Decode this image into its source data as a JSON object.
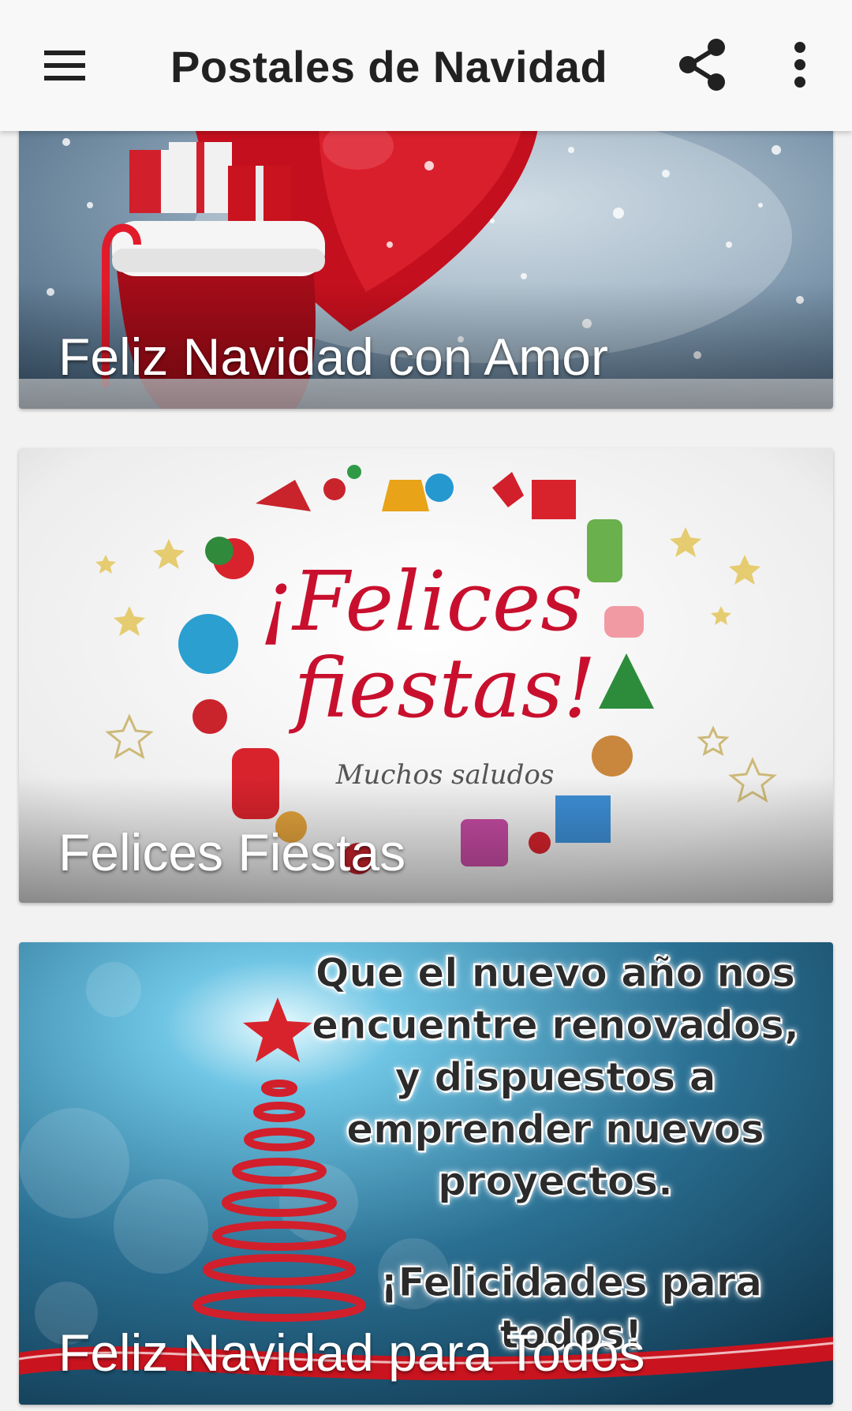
{
  "appbar": {
    "title": "Postales de Navidad",
    "menu_icon": "hamburger-menu-icon",
    "share_icon": "share-icon",
    "more_icon": "more-vert-icon"
  },
  "cards": [
    {
      "caption": "Feliz Navidad con Amor"
    },
    {
      "caption": "Felices Fiestas",
      "art_title_line1": "¡Felices",
      "art_title_line2": "fiestas!",
      "art_subtitle": "Muchos saludos"
    },
    {
      "caption": "Feliz Navidad para Todos",
      "quote_lines": [
        "Que el nuevo año nos",
        "encuentre renovados,",
        "y dispuestos a",
        "emprender nuevos",
        "proyectos."
      ],
      "quote_closing": "¡Felicidades para todos!"
    }
  ],
  "colors": {
    "appbar_bg": "#f8f8f8",
    "title": "#212121",
    "caption": "#ffffff",
    "accent_red": "#c8102e"
  }
}
